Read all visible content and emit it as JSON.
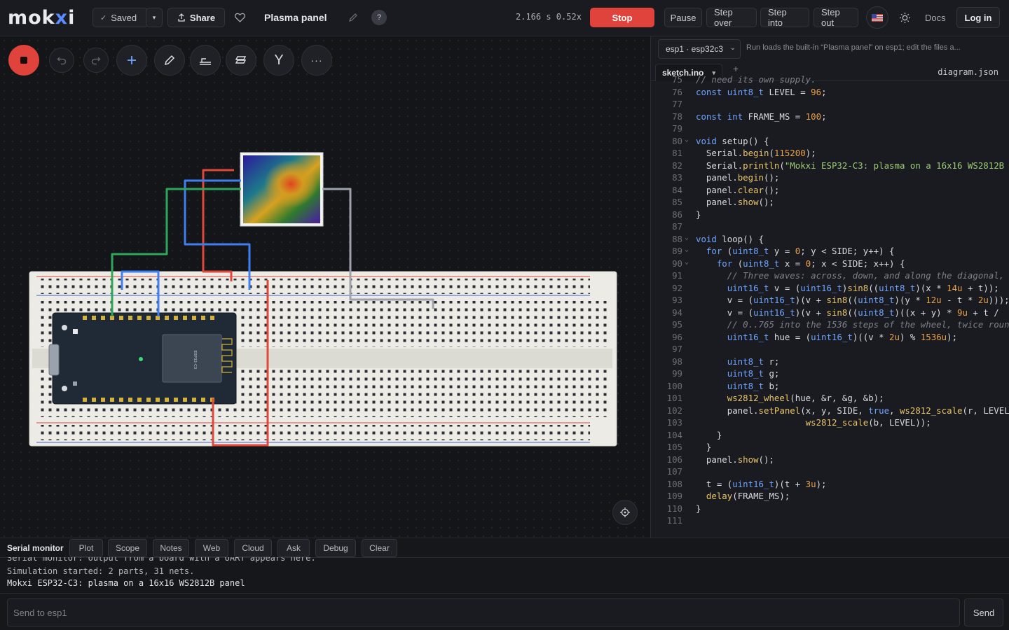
{
  "app": {
    "logo_prefix": "mok",
    "logo_accent": "x",
    "logo_suffix": "i"
  },
  "topbar": {
    "saved_label": "Saved",
    "share_label": "Share",
    "project_title": "Plasma panel",
    "help_label": "?",
    "sim_time": "2.166 s  0.52x",
    "stop_label": "Stop",
    "pause_label": "Pause",
    "step_over_label": "Step over",
    "step_into_label": "Step into",
    "step_out_label": "Step out",
    "docs_label": "Docs",
    "login_label": "Log in"
  },
  "canvas": {
    "tools": [
      "record-stop",
      "undo",
      "redo",
      "add",
      "pencil",
      "route",
      "layers",
      "y-branch",
      "more"
    ],
    "board_label": "ESP32-C3"
  },
  "editor": {
    "board_select": "esp1 · esp32c3",
    "hint": "Run loads the built-in “Plasma panel” on esp1; edit the files a...",
    "active_file": "sketch.ino",
    "other_file": "diagram.json",
    "add_tab": "+"
  },
  "code_lines": [
    {
      "n": "75",
      "t": "// need its own supply."
    },
    {
      "n": "76",
      "t": "const uint8_t LEVEL = 96;"
    },
    {
      "n": "77",
      "t": ""
    },
    {
      "n": "78",
      "t": "const int FRAME_MS = 100;"
    },
    {
      "n": "79",
      "t": ""
    },
    {
      "n": "80",
      "t": "void setup() {",
      "fold": true
    },
    {
      "n": "81",
      "t": "  Serial.begin(115200);"
    },
    {
      "n": "82",
      "t": "  Serial.println(\"Mokxi ESP32-C3: plasma on a 16x16 WS2812B"
    },
    {
      "n": "83",
      "t": "  panel.begin();"
    },
    {
      "n": "84",
      "t": "  panel.clear();"
    },
    {
      "n": "85",
      "t": "  panel.show();"
    },
    {
      "n": "86",
      "t": "}"
    },
    {
      "n": "87",
      "t": ""
    },
    {
      "n": "88",
      "t": "void loop() {",
      "fold": true
    },
    {
      "n": "89",
      "t": "  for (uint8_t y = 0; y < SIDE; y++) {",
      "fold": true
    },
    {
      "n": "90",
      "t": "    for (uint8_t x = 0; x < SIDE; x++) {",
      "fold": true
    },
    {
      "n": "91",
      "t": "      // Three waves: across, down, and along the diagonal,"
    },
    {
      "n": "92",
      "t": "      uint16_t v = (uint16_t)sin8((uint8_t)(x * 14u + t));"
    },
    {
      "n": "93",
      "t": "      v = (uint16_t)(v + sin8((uint8_t)(y * 12u - t * 2u)));"
    },
    {
      "n": "94",
      "t": "      v = (uint16_t)(v + sin8((uint8_t)((x + y) * 9u + t /"
    },
    {
      "n": "95",
      "t": "      // 0..765 into the 1536 steps of the wheel, twice roun"
    },
    {
      "n": "96",
      "t": "      uint16_t hue = (uint16_t)((v * 2u) % 1536u);"
    },
    {
      "n": "97",
      "t": ""
    },
    {
      "n": "98",
      "t": "      uint8_t r;"
    },
    {
      "n": "99",
      "t": "      uint8_t g;"
    },
    {
      "n": "100",
      "t": "      uint8_t b;"
    },
    {
      "n": "101",
      "t": "      ws2812_wheel(hue, &r, &g, &b);"
    },
    {
      "n": "102",
      "t": "      panel.setPanel(x, y, SIDE, true, ws2812_scale(r, LEVEL"
    },
    {
      "n": "103",
      "t": "                     ws2812_scale(b, LEVEL));"
    },
    {
      "n": "104",
      "t": "    }"
    },
    {
      "n": "105",
      "t": "  }"
    },
    {
      "n": "106",
      "t": "  panel.show();"
    },
    {
      "n": "107",
      "t": ""
    },
    {
      "n": "108",
      "t": "  t = (uint16_t)(t + 3u);"
    },
    {
      "n": "109",
      "t": "  delay(FRAME_MS);"
    },
    {
      "n": "110",
      "t": "}"
    },
    {
      "n": "111",
      "t": ""
    }
  ],
  "bottom": {
    "serial_label": "Serial monitor",
    "tabs": [
      "Plot",
      "Scope",
      "Notes",
      "Web",
      "Cloud",
      "Ask",
      "Debug",
      "Clear"
    ],
    "lines": [
      "Serial monitor: output from a board with a UART appears here.",
      "Simulation started: 2 parts, 31 nets.",
      "Mokxi ESP32-C3: plasma on a 16x16 WS2812B panel"
    ],
    "send_placeholder": "Send to esp1",
    "send_label": "Send"
  },
  "colors": {
    "accent": "#5b8cff",
    "stop": "#e0433b",
    "wire_red": "#e0483c",
    "wire_blue": "#3f7ff0",
    "wire_green": "#2ea65a",
    "wire_gray": "#9ea2ab"
  }
}
